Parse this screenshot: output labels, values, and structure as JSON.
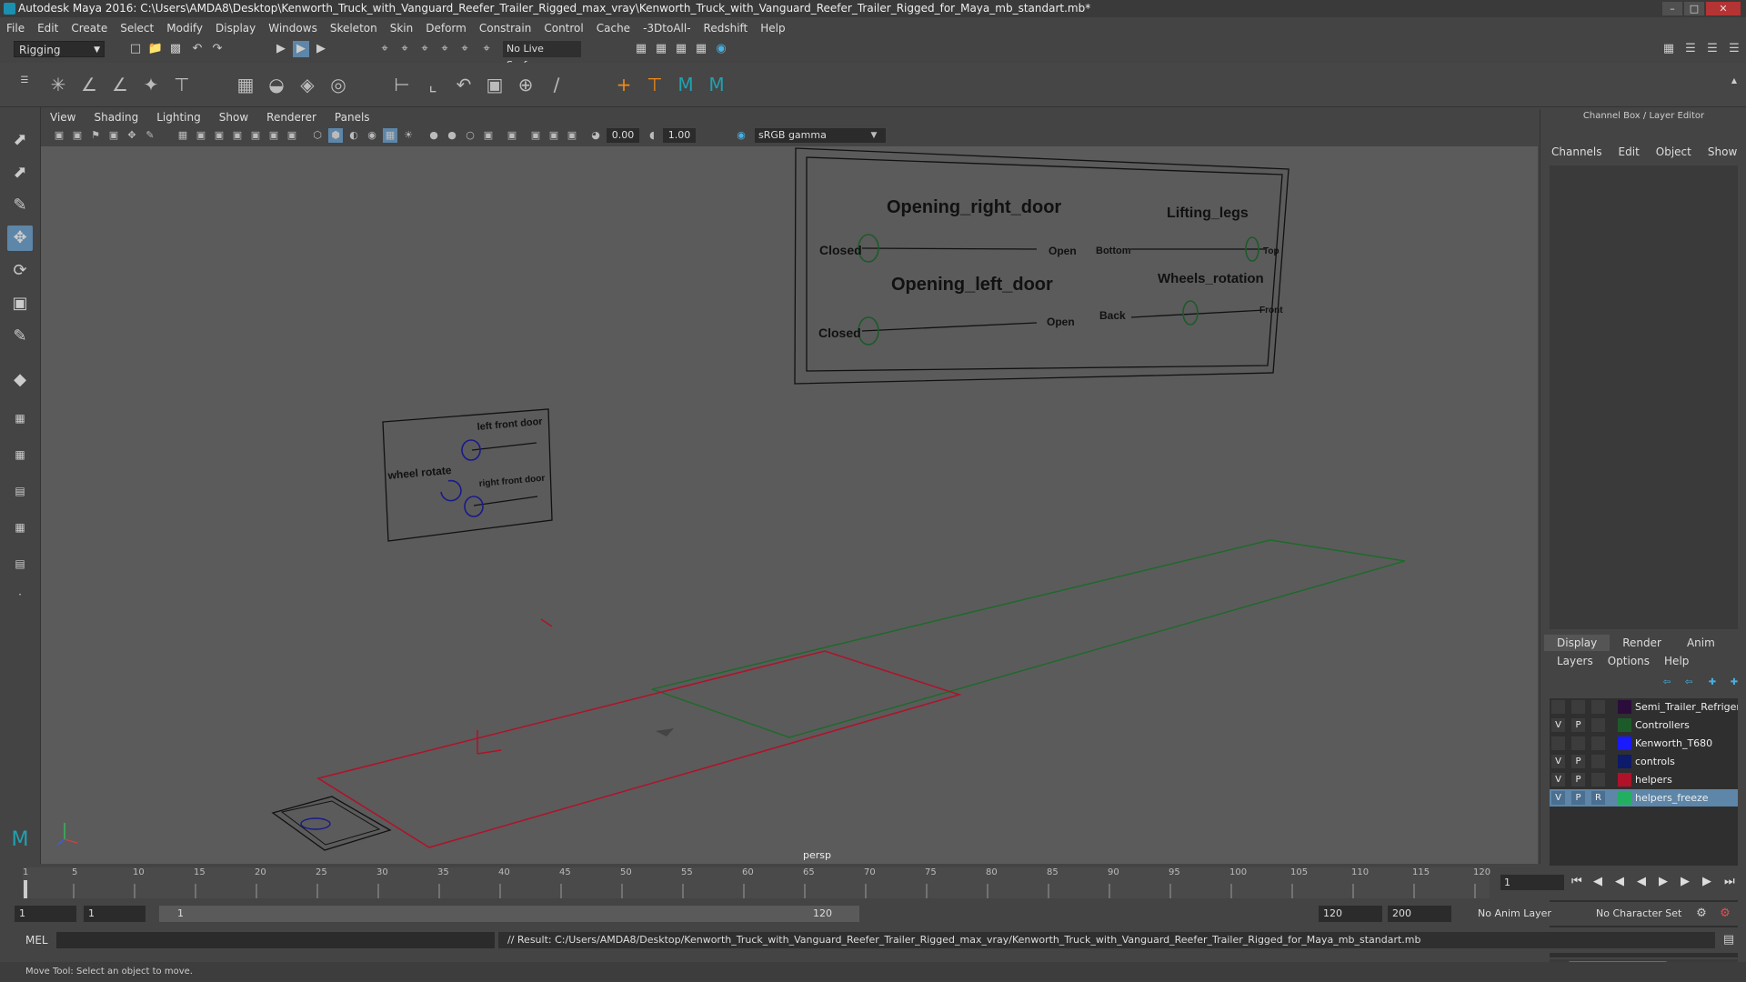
{
  "title": "Autodesk Maya 2016: C:\\Users\\AMDA8\\Desktop\\Kenworth_Truck_with_Vanguard_Reefer_Trailer_Rigged_max_vray\\Kenworth_Truck_with_Vanguard_Reefer_Trailer_Rigged_for_Maya_mb_standart.mb*",
  "menu": [
    "File",
    "Edit",
    "Create",
    "Select",
    "Modify",
    "Display",
    "Windows",
    "Skeleton",
    "Skin",
    "Deform",
    "Constrain",
    "Control",
    "Cache",
    "-3DtoAll-",
    "Redshift",
    "Help"
  ],
  "mode": "Rigging",
  "live_surface": "No Live Surface",
  "panel_menu": [
    "View",
    "Shading",
    "Lighting",
    "Show",
    "Renderer",
    "Panels"
  ],
  "exposure": "0.00",
  "gamma": "1.00",
  "color_space": "sRGB gamma",
  "camera_label": "persp",
  "scene": {
    "board_main": {
      "opening_right_door": "Opening_right_door",
      "lifting_legs": "Lifting_legs",
      "opening_left_door": "Opening_left_door",
      "wheels_rotation": "Wheels_rotation",
      "closed1": "Closed",
      "open1": "Open",
      "bottom": "Bottom",
      "top": "Top",
      "closed2": "Closed",
      "open2": "Open",
      "back": "Back",
      "front": "Front"
    },
    "board_small": {
      "left_front_door": "left front door",
      "wheel_rotate": "wheel rotate",
      "right_front_door": "right front door"
    }
  },
  "right_panel": {
    "title": "Channel Box / Layer Editor",
    "channel_tabs": [
      "Channels",
      "Edit",
      "Object",
      "Show"
    ],
    "layer_tabs": [
      "Display",
      "Render",
      "Anim"
    ],
    "layer_menu": [
      "Layers",
      "Options",
      "Help"
    ],
    "layers": [
      {
        "v": "",
        "p": "",
        "r": "",
        "color": "#2a0d3a",
        "name": "Semi_Trailer_Refrigerat"
      },
      {
        "v": "V",
        "p": "P",
        "r": "",
        "color": "#1d5a2a",
        "name": "Controllers"
      },
      {
        "v": "",
        "p": "",
        "r": "",
        "color": "#1a1aff",
        "name": "Kenworth_T680"
      },
      {
        "v": "V",
        "p": "P",
        "r": "",
        "color": "#0e1a6a",
        "name": "controls"
      },
      {
        "v": "V",
        "p": "P",
        "r": "",
        "color": "#b0122a",
        "name": "helpers"
      },
      {
        "v": "V",
        "p": "P",
        "r": "R",
        "color": "#22b060",
        "name": "helpers_freeze"
      }
    ]
  },
  "timeline": {
    "ticks": [
      "1",
      "5",
      "10",
      "15",
      "20",
      "25",
      "30",
      "35",
      "40",
      "45",
      "50",
      "55",
      "60",
      "65",
      "70",
      "75",
      "80",
      "85",
      "90",
      "95",
      "100",
      "105",
      "110",
      "115",
      "120"
    ],
    "current_frame": "1"
  },
  "range": {
    "start": "1",
    "playback_start": "1",
    "slider_start": "1",
    "slider_end": "120",
    "playback_end": "120",
    "end": "200",
    "anim_layer": "No Anim Layer",
    "character_set": "No Character Set"
  },
  "command": {
    "lang": "MEL",
    "result": "// Result: C:/Users/AMDA8/Desktop/Kenworth_Truck_with_Vanguard_Reefer_Trailer_Rigged_max_vray/Kenworth_Truck_with_Vanguard_Reefer_Trailer_Rigged_for_Maya_mb_standart.mb"
  },
  "help_line": "Move Tool: Select an object to move."
}
